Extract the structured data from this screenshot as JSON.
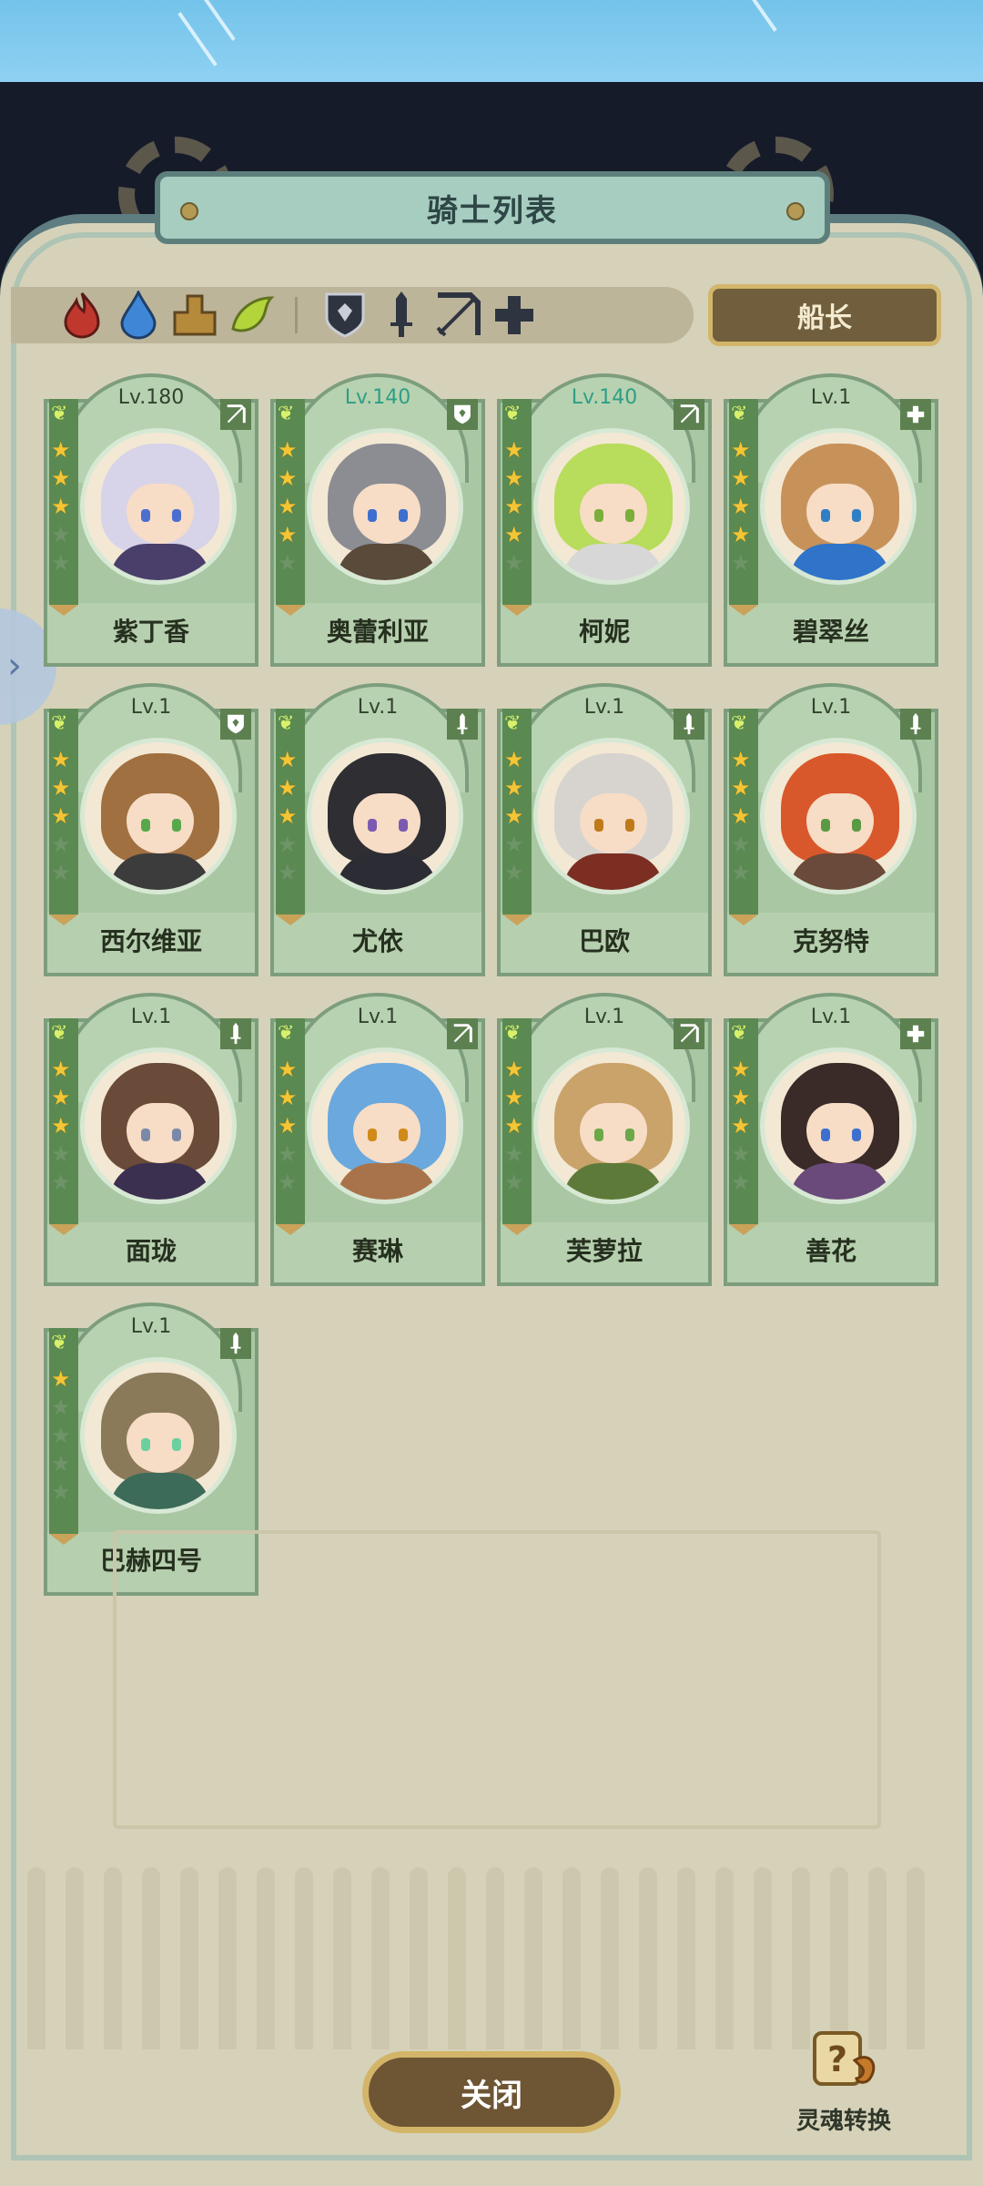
{
  "header": {
    "title": "骑士列表"
  },
  "filters": {
    "elements": [
      {
        "name": "fire-icon",
        "color": "#c0372d"
      },
      {
        "name": "water-icon",
        "color": "#3f86d6"
      },
      {
        "name": "earth-icon",
        "color": "#b68a3b"
      },
      {
        "name": "wind-icon",
        "color": "#b4d43c"
      }
    ],
    "roles": [
      {
        "name": "shield-icon"
      },
      {
        "name": "sword-icon"
      },
      {
        "name": "bow-icon"
      },
      {
        "name": "cross-icon"
      }
    ],
    "captain_label": "船长"
  },
  "knights": [
    {
      "name": "紫丁香",
      "level": "Lv.180",
      "stars": 3,
      "role": "bow-icon",
      "hair": "#d7d3e9",
      "body": "#4a3f6a",
      "eye": "#4b6fcf"
    },
    {
      "name": "奥蕾利亚",
      "level": "Lv.140",
      "stars": 4,
      "role": "shield-icon",
      "hair": "#8c8d93",
      "body": "#5a4a3a",
      "eye": "#3e6fcf"
    },
    {
      "name": "柯妮",
      "level": "Lv.140",
      "stars": 4,
      "role": "bow-icon",
      "hair": "#b8dc5b",
      "body": "#d7d7d7",
      "eye": "#7bae3a"
    },
    {
      "name": "碧翠丝",
      "level": "Lv.1",
      "stars": 4,
      "role": "cross-icon",
      "hair": "#c7925a",
      "body": "#2f74c9",
      "eye": "#2e7fc4"
    },
    {
      "name": "西尔维亚",
      "level": "Lv.1",
      "stars": 3,
      "role": "shield-icon",
      "hair": "#a07040",
      "body": "#3c3c3c",
      "eye": "#57a84a"
    },
    {
      "name": "尤依",
      "level": "Lv.1",
      "stars": 3,
      "role": "sword-icon",
      "hair": "#2e2e33",
      "body": "#2c2c34",
      "eye": "#7b5bb0"
    },
    {
      "name": "巴欧",
      "level": "Lv.1",
      "stars": 3,
      "role": "sword-icon",
      "hair": "#d7d4d0",
      "body": "#7c2e22",
      "eye": "#c07a1b"
    },
    {
      "name": "克努特",
      "level": "Lv.1",
      "stars": 3,
      "role": "sword-icon",
      "hair": "#d9582b",
      "body": "#6a4a3a",
      "eye": "#5a9a42"
    },
    {
      "name": "面珑",
      "level": "Lv.1",
      "stars": 3,
      "role": "sword-icon",
      "hair": "#6a4a38",
      "body": "#3b3050",
      "eye": "#7a89a8"
    },
    {
      "name": "赛琳",
      "level": "Lv.1",
      "stars": 3,
      "role": "bow-icon",
      "hair": "#6aa8dd",
      "body": "#a8734a",
      "eye": "#d08a1a"
    },
    {
      "name": "芙萝拉",
      "level": "Lv.1",
      "stars": 3,
      "role": "bow-icon",
      "hair": "#c9a36a",
      "body": "#5e7a3a",
      "eye": "#6aa848"
    },
    {
      "name": "善花",
      "level": "Lv.1",
      "stars": 3,
      "role": "cross-icon",
      "hair": "#3a2a28",
      "body": "#6a4a7a",
      "eye": "#3e6fcf"
    },
    {
      "name": "巴赫四号",
      "level": "Lv.1",
      "stars": 1,
      "role": "sword-icon",
      "hair": "#8a7a5a",
      "body": "#3d6b5a",
      "eye": "#6ad0a0"
    }
  ],
  "footer": {
    "close_label": "关闭",
    "soul_label": "灵魂转换"
  }
}
